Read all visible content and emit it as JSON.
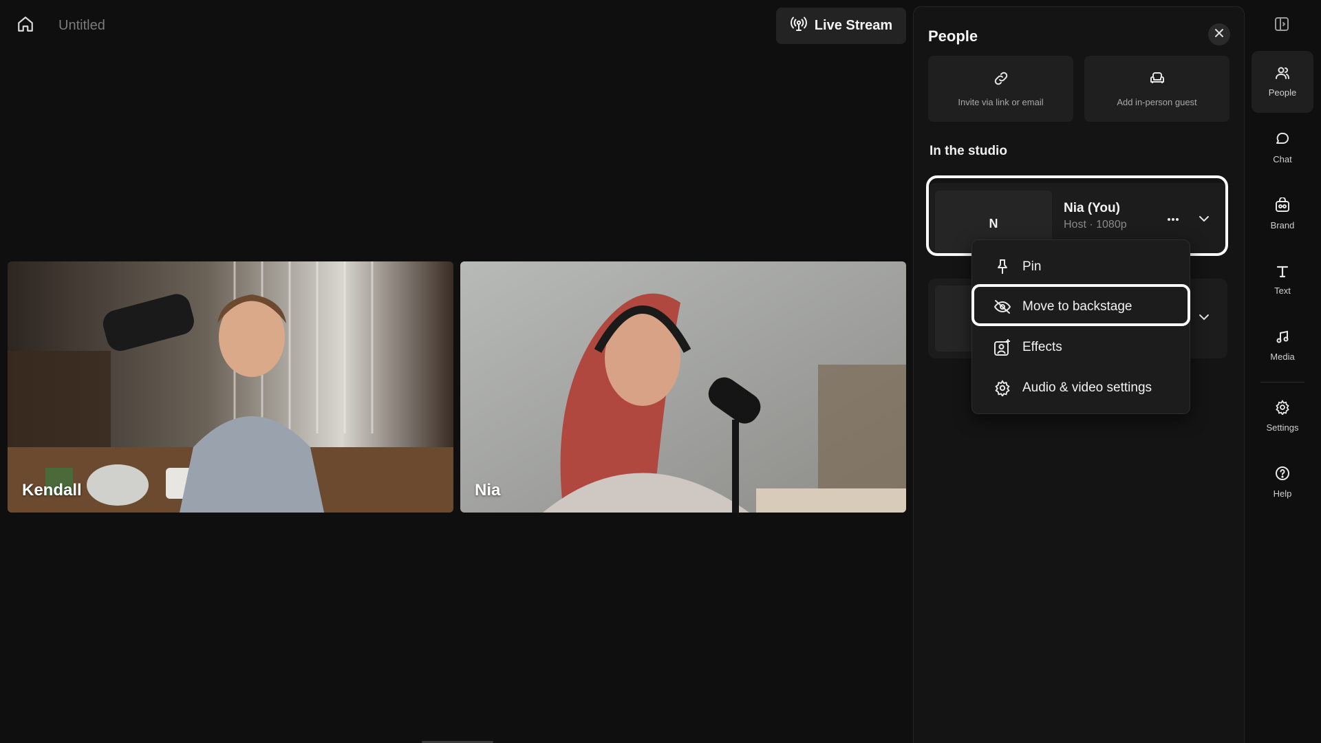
{
  "topbar": {
    "home_icon": "home-icon",
    "title": "Untitled",
    "live_stream_label": "Live Stream",
    "live_stream_icon": "broadcast-icon"
  },
  "stage": {
    "tiles": [
      {
        "name": "Kendall"
      },
      {
        "name": "Nia"
      }
    ]
  },
  "panel": {
    "title": "People",
    "actions": [
      {
        "label": "Invite via link or email",
        "icon": "link-icon"
      },
      {
        "label": "Add in-person guest",
        "icon": "chair-icon"
      }
    ],
    "section_title": "In the studio",
    "participants": [
      {
        "avatar_initial": "N",
        "name": "Nia (You)",
        "subtitle": "Host · 1080p"
      }
    ]
  },
  "menu": {
    "items": [
      {
        "label": "Pin",
        "icon": "pin-icon"
      },
      {
        "label": "Move to backstage",
        "icon": "eye-off-icon"
      },
      {
        "label": "Effects",
        "icon": "effects-icon"
      },
      {
        "label": "Audio & video settings",
        "icon": "gear-icon"
      }
    ]
  },
  "rail": {
    "items": [
      {
        "label": "People",
        "icon": "people-icon",
        "active": true
      },
      {
        "label": "Chat",
        "icon": "chat-icon"
      },
      {
        "label": "Brand",
        "icon": "brand-icon"
      },
      {
        "label": "Text",
        "icon": "text-icon"
      },
      {
        "label": "Media",
        "icon": "music-note-icon"
      },
      {
        "label": "Settings",
        "icon": "gear-icon"
      },
      {
        "label": "Help",
        "icon": "help-icon"
      }
    ]
  },
  "colors": {
    "background": "#0f0f0f",
    "panel": "#141414",
    "highlight": "#ffffff"
  }
}
